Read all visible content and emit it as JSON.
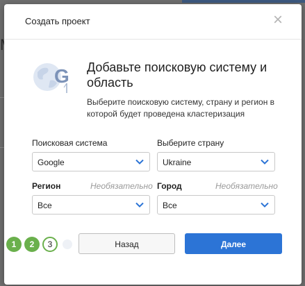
{
  "background": {
    "partial_letter": "M"
  },
  "modal": {
    "title": "Создать проект",
    "close_glyph": "×",
    "heading": "Добавьте поисковую систему и область",
    "description": "Выберите поисковую систему, страну и регион в которой будет проведена кластеризация"
  },
  "fields": {
    "search_engine": {
      "label": "Поисковая система",
      "value": "Google"
    },
    "country": {
      "label": "Выберите страну",
      "value": "Ukraine"
    },
    "region": {
      "label": "Регион",
      "optional": "Необязательно",
      "value": "Все"
    },
    "city": {
      "label": "Город",
      "optional": "Необязательно",
      "value": "Все"
    }
  },
  "steps": [
    {
      "label": "1",
      "state": "done"
    },
    {
      "label": "2",
      "state": "done"
    },
    {
      "label": "3",
      "state": "current"
    }
  ],
  "buttons": {
    "back": "Назад",
    "next": "Далее"
  },
  "colors": {
    "primary": "#2c74d6",
    "step_done": "#6ab04c",
    "logo_globe": "#c7d4e8",
    "logo_letter": "#7d93b8"
  },
  "icons": {
    "close": "close-icon",
    "logo": "globe-google-logo-icon",
    "dropdown": "chevron-down-icon"
  }
}
